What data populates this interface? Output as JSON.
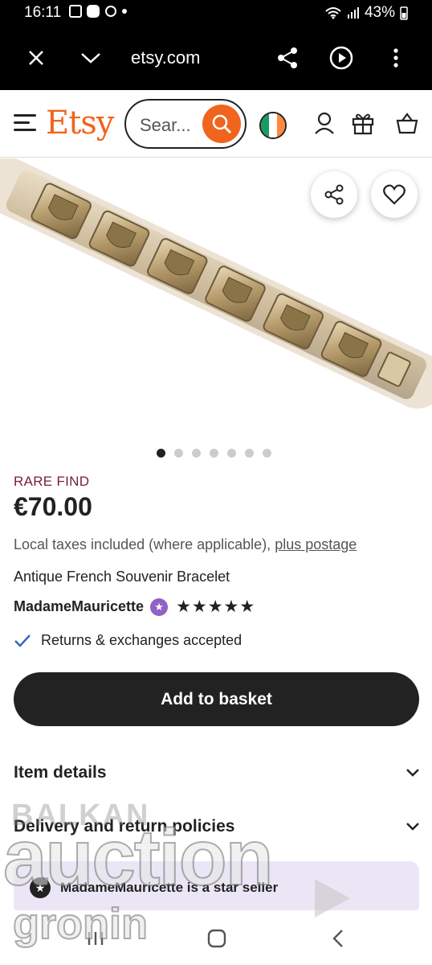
{
  "status_bar": {
    "time": "16:11",
    "battery": "43%",
    "icons": [
      "image-icon",
      "youtube-icon",
      "app-icon",
      "dot-icon",
      "wifi-icon",
      "signal-icon",
      "battery-icon"
    ]
  },
  "browser": {
    "url": "etsy.com",
    "icons": [
      "close-icon",
      "chevron-down-icon",
      "share-icon",
      "play-icon",
      "more-icon"
    ]
  },
  "header": {
    "logo": "Etsy",
    "search_placeholder": "Sear...",
    "icons": [
      "menu-icon",
      "search-icon",
      "ireland-flag-icon",
      "account-icon",
      "gift-icon",
      "basket-icon"
    ]
  },
  "carousel": {
    "image_alt": "Antique French Souvenir Bracelet",
    "slide_count": 7,
    "active_slide": 1
  },
  "listing": {
    "badge": "RARE FIND",
    "price": "€70.00",
    "taxes_text": "Local taxes included (where applicable),",
    "postage_link": "plus postage",
    "title": "Antique French Souvenir Bracelet",
    "seller": "MadameMauricette",
    "stars": "★★★★★",
    "rating": 5,
    "returns": "Returns & exchanges accepted"
  },
  "actions": {
    "add_to_basket": "Add to basket"
  },
  "sections": {
    "item_details": "Item details",
    "delivery": "Delivery and return policies"
  },
  "star_seller": {
    "text": "MadameMauricette is a star seller"
  },
  "watermark": {
    "line1": "BALKAN",
    "line2": "auction",
    "line3": "gronin"
  },
  "colors": {
    "etsy_orange": "#f1641e",
    "rare_find": "#7a1b3e",
    "star_seller_bg": "#ebe6f6",
    "star_badge": "#8f62c4",
    "primary_button": "#222222"
  }
}
